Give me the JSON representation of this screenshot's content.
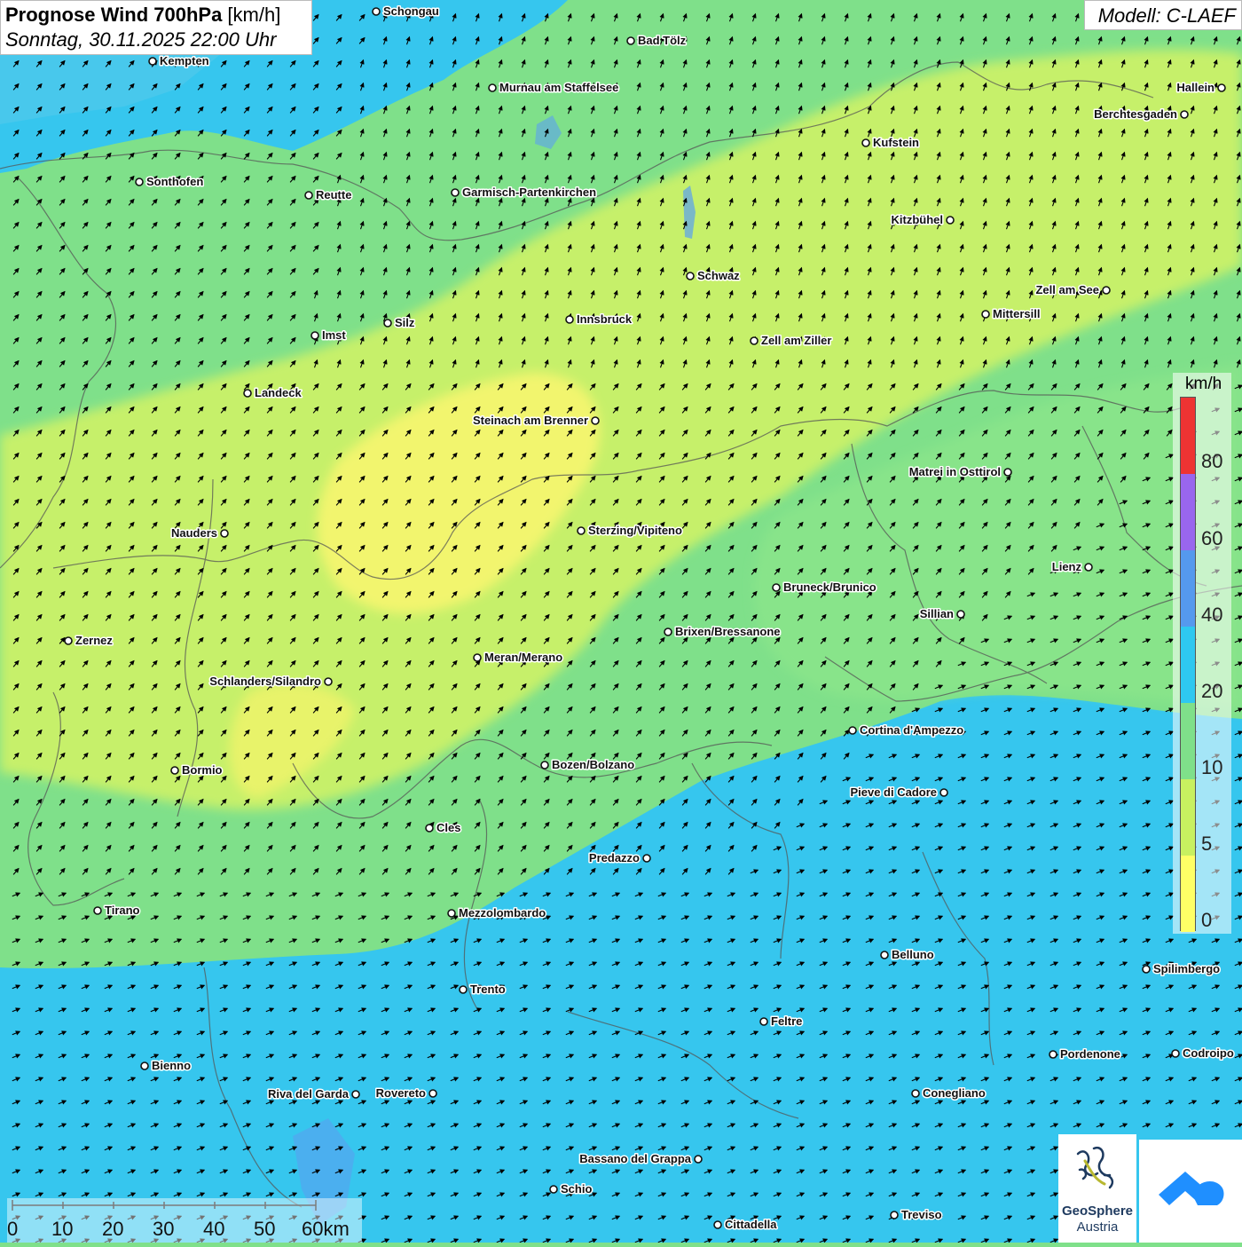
{
  "header": {
    "title_bold": "Prognose Wind 700hPa",
    "title_unit": " [km/h]",
    "datetime": "Sonntag, 30.11.2025 22:00 Uhr"
  },
  "model_label": "Modell: C-LAEF",
  "legend": {
    "unit": "km/h",
    "bands": [
      {
        "from": 0,
        "to": 5,
        "color": "#ffff66"
      },
      {
        "from": 5,
        "to": 10,
        "color": "#c8f060"
      },
      {
        "from": 10,
        "to": 20,
        "color": "#7fe08a"
      },
      {
        "from": 20,
        "to": 40,
        "color": "#2ec8f0"
      },
      {
        "from": 40,
        "to": 60,
        "color": "#5599ee"
      },
      {
        "from": 60,
        "to": 80,
        "color": "#9966ee"
      },
      {
        "from": 80,
        "to": 999,
        "color": "#ee3333"
      }
    ],
    "labels": [
      "0",
      "5",
      "10",
      "20",
      "40",
      "60",
      "80"
    ]
  },
  "scale_bar": {
    "labels": [
      "0",
      "10",
      "20",
      "30",
      "40",
      "50",
      "60km"
    ]
  },
  "logos": {
    "geosphere_line1": "GeoSphere",
    "geosphere_line2": "Austria"
  },
  "colors": {
    "ocean_blue": "#36c6ee",
    "light_green": "#7fe08a",
    "yellow_green": "#c6f06a",
    "yellow": "#f2f56e",
    "logo_blue": "#1f8fff"
  },
  "wind": {
    "direction": "southwest (arrows point north-east)",
    "arrow_icon": "wind-arrow-icon"
  },
  "cities": [
    {
      "name": "Schongau"
    },
    {
      "name": "Bad Tölz"
    },
    {
      "name": "Kempten"
    },
    {
      "name": "Murnau am Staffelsee"
    },
    {
      "name": "Hallein"
    },
    {
      "name": "Berchtesgaden"
    },
    {
      "name": "Kufstein"
    },
    {
      "name": "Sonthofen"
    },
    {
      "name": "Reutte"
    },
    {
      "name": "Garmisch-Partenkirchen"
    },
    {
      "name": "Kitzbühel"
    },
    {
      "name": "Schwaz"
    },
    {
      "name": "Zell am See"
    },
    {
      "name": "Mittersill"
    },
    {
      "name": "Innsbruck"
    },
    {
      "name": "Silz"
    },
    {
      "name": "Imst"
    },
    {
      "name": "Zell am Ziller"
    },
    {
      "name": "Landeck"
    },
    {
      "name": "Steinach am Brenner"
    },
    {
      "name": "Matrei in Osttirol"
    },
    {
      "name": "Nauders"
    },
    {
      "name": "Sterzing/Vipiteno"
    },
    {
      "name": "Lienz"
    },
    {
      "name": "Bruneck/Brunico"
    },
    {
      "name": "Sillian"
    },
    {
      "name": "Zernez"
    },
    {
      "name": "Brixen/Bressanone"
    },
    {
      "name": "Meran/Merano"
    },
    {
      "name": "Schlanders/Silandro"
    },
    {
      "name": "Cortina d'Ampezzo"
    },
    {
      "name": "Bormio"
    },
    {
      "name": "Bozen/Bolzano"
    },
    {
      "name": "Pieve di Cadore"
    },
    {
      "name": "Cles"
    },
    {
      "name": "Predazzo"
    },
    {
      "name": "Tirano"
    },
    {
      "name": "Mezzolombardo"
    },
    {
      "name": "Belluno"
    },
    {
      "name": "Spilimbergo"
    },
    {
      "name": "Trento"
    },
    {
      "name": "Feltre"
    },
    {
      "name": "Pordenone"
    },
    {
      "name": "Codroipo"
    },
    {
      "name": "Bienno"
    },
    {
      "name": "Riva del Garda"
    },
    {
      "name": "Rovereto"
    },
    {
      "name": "Conegliano"
    },
    {
      "name": "Bassano del Grappa"
    },
    {
      "name": "Schio"
    },
    {
      "name": "Treviso"
    },
    {
      "name": "Cittadella"
    }
  ]
}
